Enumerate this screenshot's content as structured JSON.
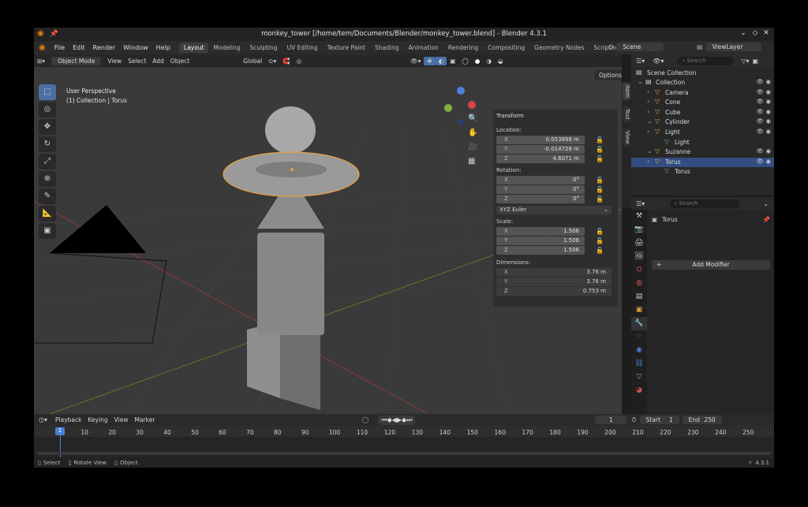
{
  "window": {
    "title": "monkey_tower [/home/tem/Documents/Blender/monkey_tower.blend] - Blender 4.3.1"
  },
  "menus": [
    "File",
    "Edit",
    "Render",
    "Window",
    "Help"
  ],
  "workspaces": [
    "Layout",
    "Modeling",
    "Sculpting",
    "UV Editing",
    "Texture Paint",
    "Shading",
    "Animation",
    "Rendering",
    "Compositing",
    "Geometry Nodes",
    "Scripting"
  ],
  "scene": {
    "name": "Scene",
    "view_layer": "ViewLayer"
  },
  "viewport": {
    "mode": "Object Mode",
    "menus": [
      "View",
      "Select",
      "Add",
      "Object"
    ],
    "orientation": "Global",
    "options": "Options",
    "info_line1": "User Perspective",
    "info_line2": "(1) Collection | Torus"
  },
  "transform": {
    "title": "Transform",
    "location_label": "Location:",
    "location": [
      {
        "axis": "X",
        "value": "0.053898 m"
      },
      {
        "axis": "Y",
        "value": "-0.014728 m"
      },
      {
        "axis": "Z",
        "value": "4.6071 m"
      }
    ],
    "rotation_label": "Rotation:",
    "rotation": [
      {
        "axis": "X",
        "value": "0°"
      },
      {
        "axis": "Y",
        "value": "0°"
      },
      {
        "axis": "Z",
        "value": "0°"
      }
    ],
    "rotation_mode": "XYZ Euler",
    "scale_label": "Scale:",
    "scale": [
      {
        "axis": "X",
        "value": "1.506"
      },
      {
        "axis": "Y",
        "value": "1.506"
      },
      {
        "axis": "Z",
        "value": "1.506"
      }
    ],
    "dimensions_label": "Dimensions:",
    "dimensions": [
      {
        "axis": "X",
        "value": "3.76 m"
      },
      {
        "axis": "Y",
        "value": "3.76 m"
      },
      {
        "axis": "Z",
        "value": "0.753 m"
      }
    ]
  },
  "npanel_tabs": [
    "Item",
    "Tool",
    "View"
  ],
  "outliner": {
    "search_placeholder": "Search",
    "root": "Scene Collection",
    "items": [
      {
        "name": "Collection",
        "indent": 1
      },
      {
        "name": "Camera",
        "indent": 2,
        "icon_color": "#e8a040"
      },
      {
        "name": "Cone",
        "indent": 2,
        "icon_color": "#e8a040"
      },
      {
        "name": "Cube",
        "indent": 2,
        "icon_color": "#e8a040"
      },
      {
        "name": "Cylinder",
        "indent": 2,
        "icon_color": "#e8a040"
      },
      {
        "name": "Light",
        "indent": 2,
        "icon_color": "#e8a040"
      },
      {
        "name": "Light",
        "indent": 3,
        "icon_color": "#66bb66"
      },
      {
        "name": "Suzanne",
        "indent": 2,
        "icon_color": "#e8a040"
      },
      {
        "name": "Torus",
        "indent": 2,
        "icon_color": "#e8a040",
        "selected": true
      },
      {
        "name": "Torus",
        "indent": 3,
        "icon_color": "#66bb66"
      }
    ]
  },
  "properties": {
    "search_placeholder": "Search",
    "object_name": "Torus",
    "add_modifier": "Add Modifier"
  },
  "timeline": {
    "menus": [
      "Playback",
      "Keying",
      "View",
      "Marker"
    ],
    "current_frame": "1",
    "start_label": "Start",
    "start": "1",
    "end_label": "End",
    "end": "250",
    "ticks": [
      "1",
      "10",
      "20",
      "30",
      "40",
      "50",
      "60",
      "70",
      "80",
      "90",
      "100",
      "110",
      "120",
      "130",
      "140",
      "150",
      "160",
      "170",
      "180",
      "190",
      "200",
      "210",
      "220",
      "230",
      "240",
      "250"
    ]
  },
  "status": {
    "select": "Select",
    "rotate": "Rotate View",
    "object": "Object",
    "version": "4.3.1"
  },
  "colors": {
    "accent": "#4a6fa5",
    "selection": "#e8a040",
    "x_axis": "#d84848",
    "y_axis": "#80b040",
    "z_axis": "#4a80d8"
  }
}
